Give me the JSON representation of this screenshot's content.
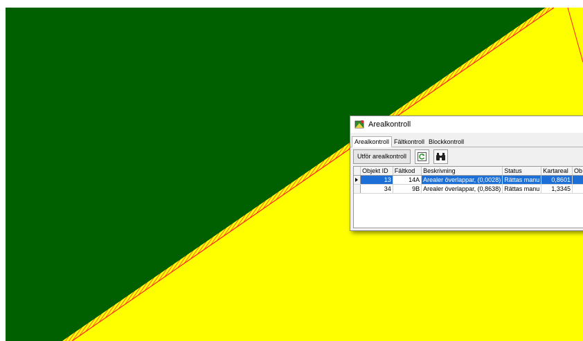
{
  "dialog": {
    "title": "Arealkontroll",
    "tabs": [
      "Arealkontroll",
      "Fältkontroll",
      "Blockkontroll"
    ],
    "active_tab": "Arealkontroll",
    "toolbar": {
      "run_label": "Utför arealkontroll",
      "refresh_icon": "refresh-icon",
      "find_icon": "binoculars-icon"
    },
    "columns": [
      "Objekt ID",
      "Fältkod",
      "Beskrivning",
      "Status",
      "Kartareal",
      "Ob"
    ],
    "rows": [
      {
        "objekt_id": "13",
        "faltkod": "14A",
        "beskrivning": "Arealer överlappar, (0,0028)",
        "status": "Rättas manu",
        "kartareal": "0,8601",
        "selected": true
      },
      {
        "objekt_id": "34",
        "faltkod": "9B",
        "beskrivning": "Arealer överlappar, (0,8638)",
        "status": "Rättas manu",
        "kartareal": "1,3345",
        "selected": false
      }
    ]
  },
  "colors": {
    "green_area": "#006000",
    "yellow_area": "#ffff00",
    "boundary": "#ff2020",
    "selection": "#1c6fd6"
  }
}
